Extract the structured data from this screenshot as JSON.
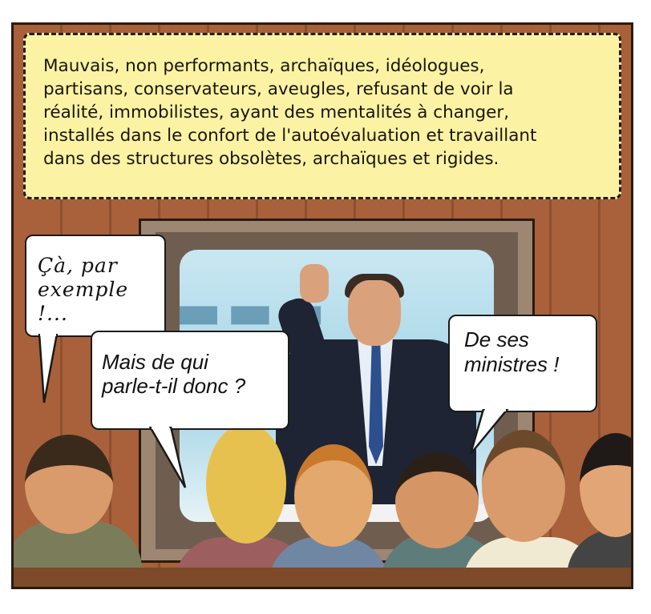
{
  "caption": {
    "lines": [
      "Mauvais, non performants, archaïques, idéologues,",
      "partisans, conservateurs, aveugles, refusant de voir la",
      "réalité, immobilistes, ayant  des mentalités à changer,",
      "installés dans le confort de l'autoévaluation et travaillant",
      "dans des structures obsolètes, archaïques et rigides."
    ]
  },
  "bubbles": {
    "left_top": {
      "lines": [
        "Çà, par",
        "exemple !..."
      ]
    },
    "left_bottom": {
      "lines": [
        "Mais de qui",
        "parle-t-il donc ?"
      ]
    },
    "right": {
      "lines": [
        "De ses",
        "ministres !"
      ]
    }
  },
  "colors": {
    "caption_bg": "#fbf3a3",
    "wall": "#a8613a",
    "frame": "#2a1a10"
  }
}
